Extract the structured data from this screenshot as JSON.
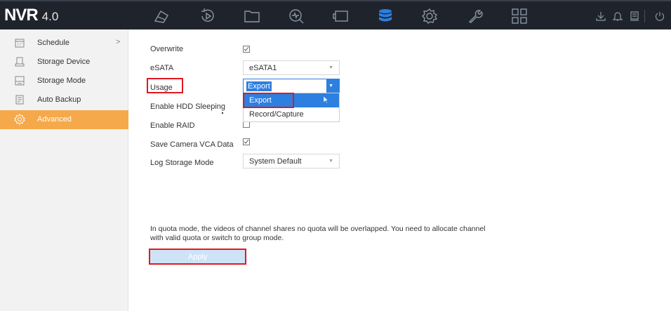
{
  "app": {
    "brand_main": "NVR",
    "brand_version": "4.0"
  },
  "topbar": {
    "nav_icons": [
      "live-view-icon",
      "playback-icon",
      "file-management-icon",
      "smart-analysis-icon",
      "camera-icon",
      "storage-icon",
      "system-settings-icon",
      "maintenance-icon",
      "menu-grid-icon"
    ],
    "active_icon": "storage-icon",
    "system_icons": [
      "download-icon",
      "alarm-bell-icon",
      "user-icon",
      "power-icon"
    ],
    "accent_color": "#2d7fe0"
  },
  "sidebar": {
    "items": [
      {
        "label": "Schedule",
        "icon": "calendar-icon",
        "has_submenu": true
      },
      {
        "label": "Storage Device",
        "icon": "device-icon"
      },
      {
        "label": "Storage Mode",
        "icon": "disk-icon"
      },
      {
        "label": "Auto Backup",
        "icon": "backup-icon"
      },
      {
        "label": "Advanced",
        "icon": "gear-icon",
        "active": true
      }
    ],
    "active_color": "#f5a94a",
    "chevron": ">"
  },
  "form": {
    "overwrite": {
      "label": "Overwrite",
      "checked": true
    },
    "esata": {
      "label": "eSATA",
      "value": "eSATA1"
    },
    "usage": {
      "label": "Usage",
      "value": "Export",
      "options": [
        "Export",
        "Record/Capture"
      ]
    },
    "hdd_sleeping": {
      "label": "Enable HDD Sleeping",
      "checked": false
    },
    "raid": {
      "label": "Enable RAID",
      "checked": false
    },
    "vca": {
      "label": "Save Camera VCA Data",
      "checked": true
    },
    "log_storage": {
      "label": "Log Storage Mode",
      "value": "System Default"
    }
  },
  "note": "In quota mode, the videos of channel shares no quota will be overlapped. You need to allocate channel with valid quota or switch to group mode.",
  "apply_label": "Apply",
  "highlight_color": "#e0191f"
}
